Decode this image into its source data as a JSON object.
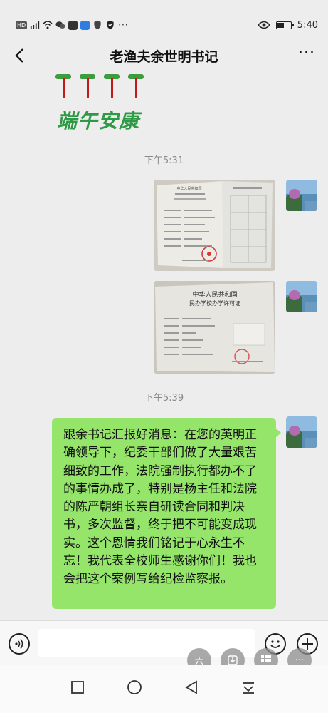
{
  "status_bar": {
    "left_icons": [
      "hd-icon",
      "signal-icon",
      "wifi-icon",
      "wechat-icon",
      "app-icon",
      "search-app-icon",
      "shield-icon",
      "vpn-icon"
    ],
    "hd_label": "HD",
    "more_label": "···",
    "time": "5:40",
    "battery_level": 0.45
  },
  "header": {
    "title": "老渔夫余世明书记",
    "more_label": "···"
  },
  "messages": [
    {
      "type": "sticker",
      "text": "端午安康"
    },
    {
      "type": "time",
      "text": "下午5:31"
    },
    {
      "type": "image",
      "description_icon": "certificate-photo"
    },
    {
      "type": "image",
      "description_icon": "license-photo"
    },
    {
      "type": "time",
      "text": "下午5:39"
    },
    {
      "type": "text",
      "text": "跟余书记汇报好消息：在您的英明正确领导下，纪委干部们做了大量艰苦细致的工作，法院强制执行都办不了的事情办成了，特别是杨主任和法院的陈严朝组长亲自研读合同和判决书，多次监督，终于把不可能变成现实。这个恩情我们铭记于心永生不忘！我代表全校师生感谢你们！我也会把这个案例写给纪检监察报。"
    }
  ],
  "certificate_texts": {
    "cert1_heading": "中华人民共和国",
    "cert2_heading": "中华人民共和国",
    "cert2_subheading": "民办学校办学许可证"
  },
  "float_buttons": [
    {
      "label": "六",
      "icon": "six-icon"
    },
    {
      "label": "",
      "icon": "download-icon"
    },
    {
      "label": "",
      "icon": "grid-icon"
    },
    {
      "label": "···",
      "icon": "more-icon"
    }
  ],
  "colors": {
    "chat_bg": "#ededed",
    "bubble_green": "#95e56a",
    "sticker_green": "#2f9a45",
    "sticker_red": "#c21a1a"
  }
}
